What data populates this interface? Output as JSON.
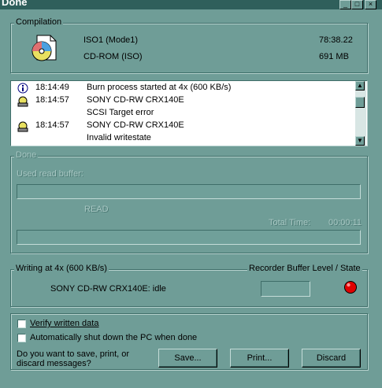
{
  "window": {
    "title": "Done",
    "controls": [
      "_",
      "□",
      "×"
    ]
  },
  "compilation": {
    "legend": "Compilation",
    "name": "ISO1 (Mode1)",
    "type": "CD-ROM (ISO)",
    "duration": "78:38.22",
    "size": "691 MB"
  },
  "log": [
    {
      "icon": "info-icon",
      "time": "18:14:49",
      "device": "Burn process started at 4x (600 KB/s)",
      "message": ""
    },
    {
      "icon": "disc-drive-icon",
      "time": "18:14:57",
      "device": "SONY     CD-RW  CRX140E",
      "message": "SCSI Target error"
    },
    {
      "icon": "disc-drive-icon",
      "time": "18:14:57",
      "device": "SONY     CD-RW  CRX140E",
      "message": "Invalid writestate"
    }
  ],
  "done_panel": {
    "legend": "Done",
    "used_read_buffer_label": "Used read buffer:",
    "read_label": "READ",
    "total_time_label": "Total Time:",
    "total_time_value": "00:00:11"
  },
  "writing": {
    "legend": "Writing at 4x (600 KB/s)",
    "recorder_label": "Recorder Buffer Level / State",
    "device_status": "SONY CD-RW CRX140E: idle",
    "state_color": "#e00000"
  },
  "options": {
    "verify_label": "Verify written data",
    "shutdown_label": "Automatically shut down the PC when done",
    "prompt": "Do you want to save, print, or discard messages?",
    "save_button": "Save...",
    "print_button": "Print...",
    "discard_button": "Discard"
  }
}
